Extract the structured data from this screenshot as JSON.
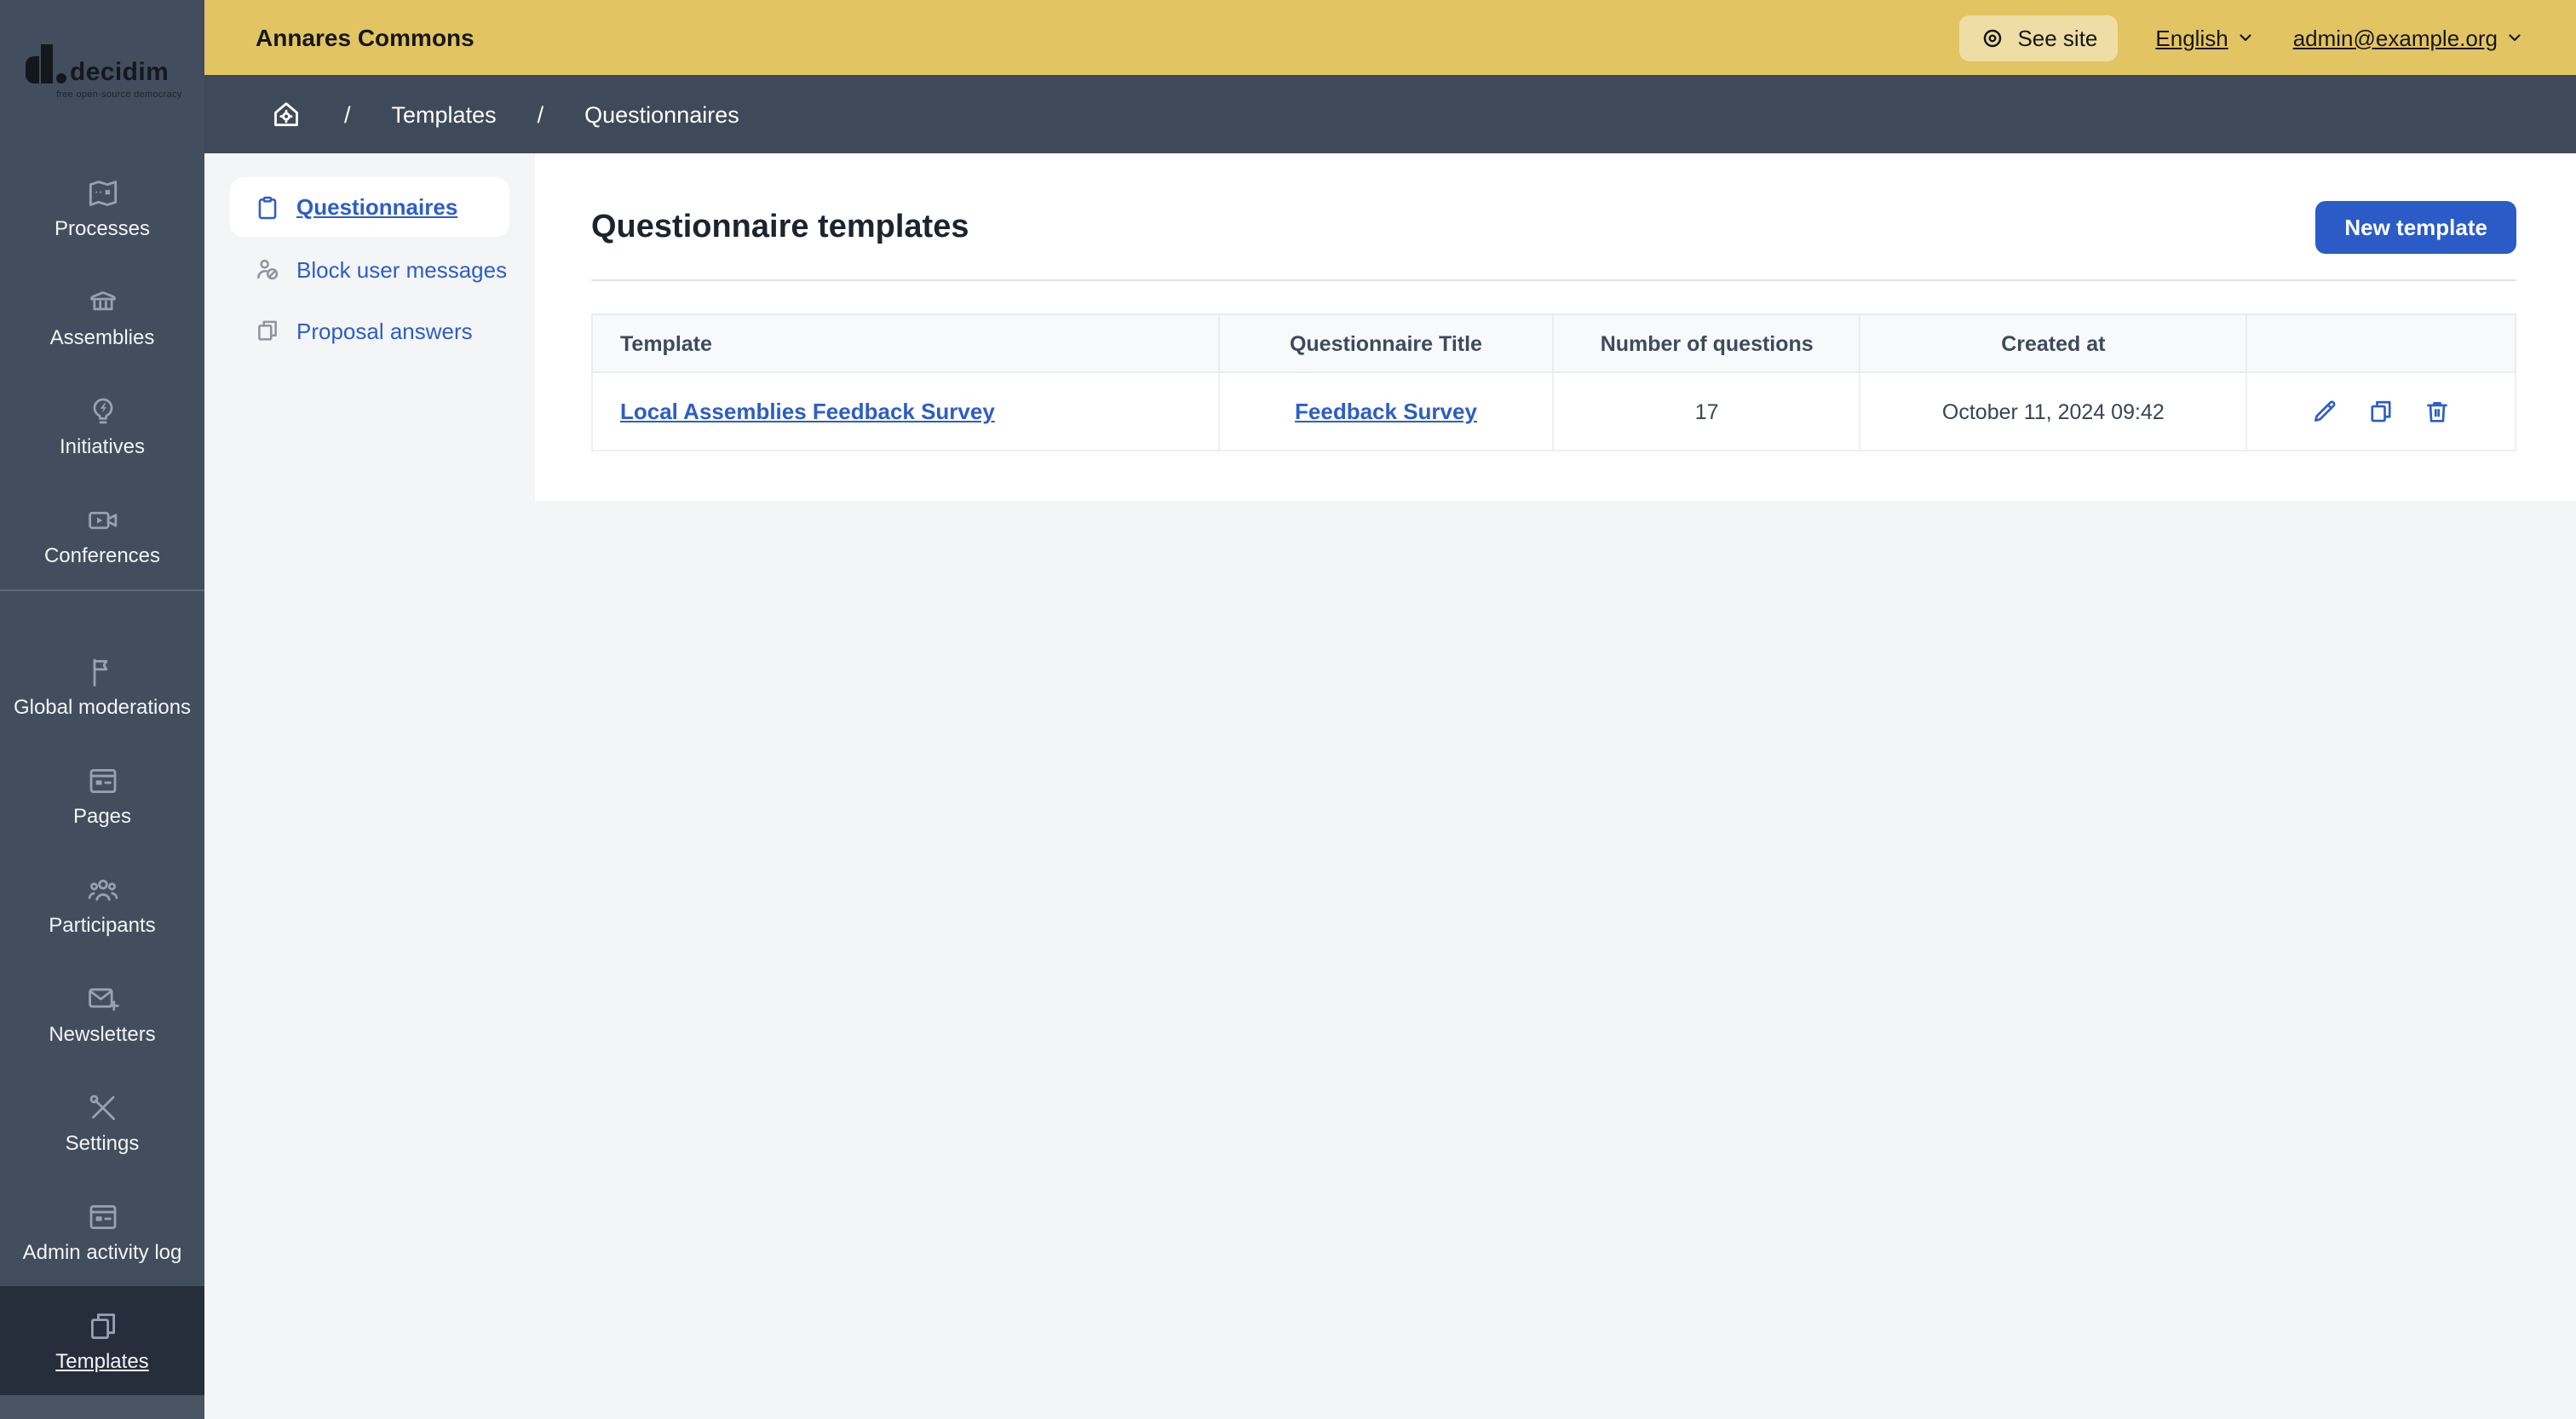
{
  "colors": {
    "topbar_yellow": "#e2c463",
    "primary_blue": "#2d5ec4",
    "button_blue": "#2b5bc7",
    "sidebar_slate": "#424e5d",
    "breadcrumb_slate": "#3e4a59",
    "sidebar_active": "#262e3c",
    "content_gray": "#f4f5f7"
  },
  "logo": {
    "brand": "decidim",
    "tagline": "free open-source democracy"
  },
  "topbar": {
    "title": "Annares Commons",
    "see_site_label": "See site",
    "language_label": "English",
    "account_label": "admin@example.org"
  },
  "breadcrumb": {
    "separator": "/",
    "items": [
      "Templates",
      "Questionnaires"
    ]
  },
  "sidebar": {
    "groups": [
      {
        "items": [
          {
            "label": "Processes",
            "icon": "map-icon"
          },
          {
            "label": "Assemblies",
            "icon": "bank-icon"
          },
          {
            "label": "Initiatives",
            "icon": "lightbulb-bolt-icon"
          },
          {
            "label": "Conferences",
            "icon": "video-camera-icon"
          }
        ]
      },
      {
        "items": [
          {
            "label": "Global moderations",
            "icon": "flag-icon"
          },
          {
            "label": "Pages",
            "icon": "browser-page-icon"
          },
          {
            "label": "Participants",
            "icon": "people-icon"
          },
          {
            "label": "Newsletters",
            "icon": "envelope-plus-icon"
          },
          {
            "label": "Settings",
            "icon": "tools-icon"
          },
          {
            "label": "Admin activity log",
            "icon": "browser-page-icon"
          },
          {
            "label": "Templates",
            "icon": "copy-pages-icon",
            "active": true
          }
        ]
      }
    ]
  },
  "subnav": {
    "items": [
      {
        "label": "Questionnaires",
        "icon": "clipboard-icon",
        "active": true
      },
      {
        "label": "Block user messages",
        "icon": "user-block-icon"
      },
      {
        "label": "Proposal answers",
        "icon": "copy-pages-icon"
      }
    ]
  },
  "main": {
    "title": "Questionnaire templates",
    "new_template_button": "New template",
    "table": {
      "columns": [
        "Template",
        "Questionnaire Title",
        "Number of questions",
        "Created at",
        ""
      ],
      "rows": [
        {
          "template": "Local Assemblies Feedback Survey",
          "questionnaire_title": "Feedback Survey",
          "number_of_questions": "17",
          "created_at": "October 11, 2024 09:42",
          "actions": [
            "edit",
            "duplicate",
            "delete"
          ]
        }
      ]
    }
  }
}
